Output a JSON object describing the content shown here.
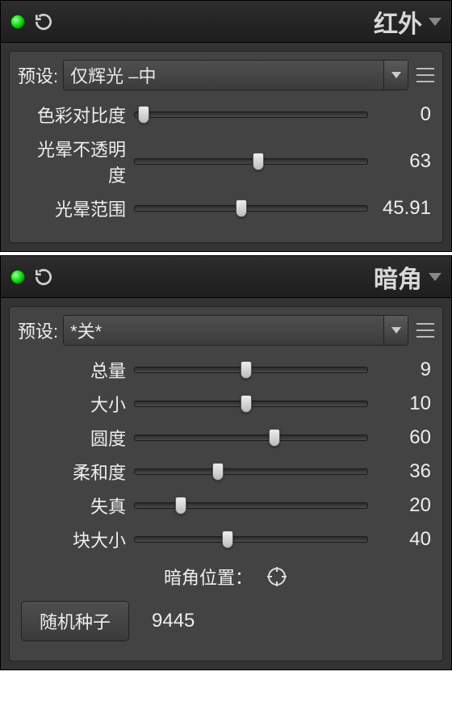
{
  "panels": [
    {
      "title": "红外",
      "preset_label": "预设:",
      "preset_value": "仅辉光 –中",
      "sliders": [
        {
          "label": "色彩对比度",
          "value": "0",
          "pos": 4
        },
        {
          "label": "光晕不透明度",
          "value": "63",
          "pos": 53
        },
        {
          "label": "光晕范围",
          "value": "45.91",
          "pos": 46
        }
      ]
    },
    {
      "title": "暗角",
      "preset_label": "预设:",
      "preset_value": "*关*",
      "sliders": [
        {
          "label": "总量",
          "value": "9",
          "pos": 48
        },
        {
          "label": "大小",
          "value": "10",
          "pos": 48
        },
        {
          "label": "圆度",
          "value": "60",
          "pos": 60
        },
        {
          "label": "柔和度",
          "value": "36",
          "pos": 36
        },
        {
          "label": "失真",
          "value": "20",
          "pos": 20
        },
        {
          "label": "块大小",
          "value": "40",
          "pos": 40
        }
      ],
      "position_label": "暗角位置：",
      "seed_button": "随机种子",
      "seed_value": "9445"
    }
  ]
}
